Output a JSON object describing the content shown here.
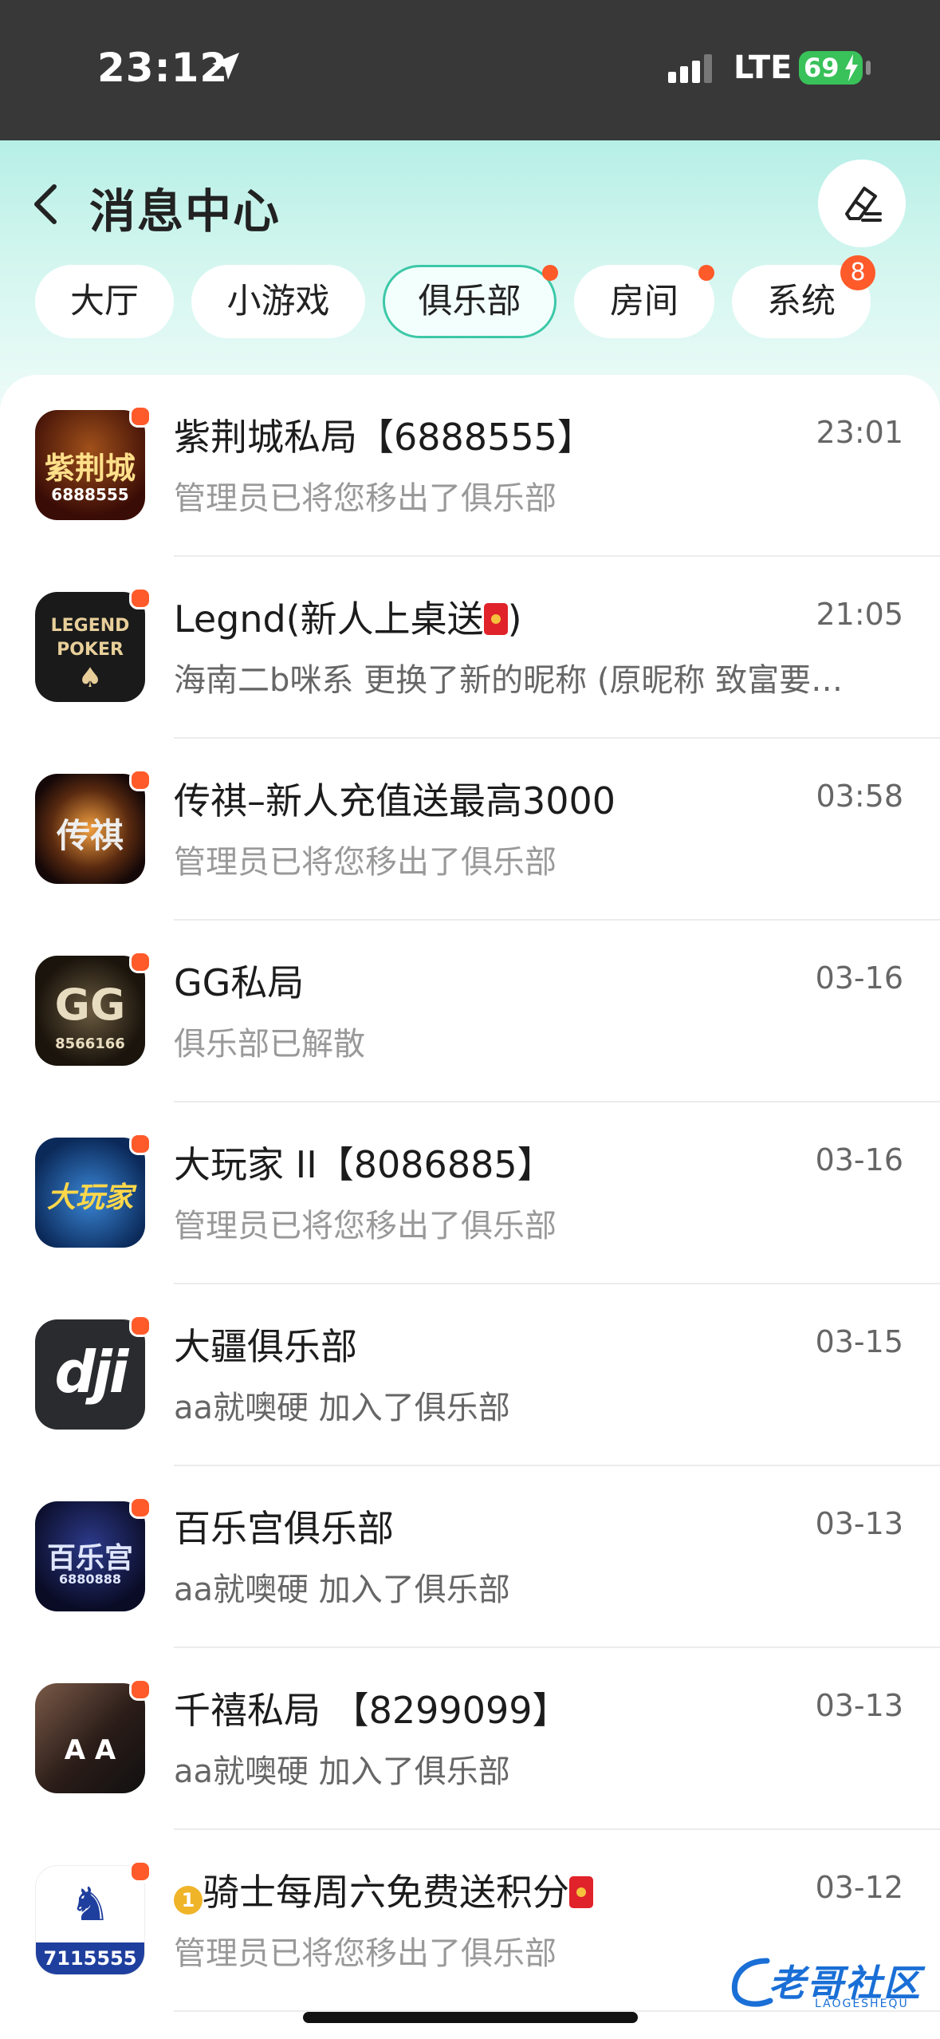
{
  "status_bar": {
    "time": "23:12",
    "network": "LTE",
    "battery": "69"
  },
  "header": {
    "title": "消息中心"
  },
  "tabs": [
    {
      "label": "大厅"
    },
    {
      "label": "小游戏"
    },
    {
      "label": "俱乐部"
    },
    {
      "label": "房间"
    },
    {
      "label": "系统",
      "badge": "8"
    }
  ],
  "messages": [
    {
      "name": "紫荆城私局【6888555】",
      "time": "23:01",
      "preview": "管理员已将您移出了俱乐部",
      "avatar_text": "紫荆城",
      "avatar_sub": "6888555"
    },
    {
      "name": "Legnd(新人上桌送",
      "name_tail": ")",
      "time": "21:05",
      "preview": "海南二b咪系 更换了新的昵称 (原昵称 致富要…",
      "avatar_text": "LEGEND",
      "avatar_sub": "POKER"
    },
    {
      "name": "传祺–新人充值送最高3000",
      "time": "03:58",
      "preview": "管理员已将您移出了俱乐部",
      "avatar_text": "传祺"
    },
    {
      "name": "GG私局",
      "time": "03-16",
      "preview": "俱乐部已解散",
      "avatar_text": "GG",
      "avatar_sub": "8566166"
    },
    {
      "name": "大玩家 II【8086885】",
      "time": "03-16",
      "preview": "管理员已将您移出了俱乐部",
      "avatar_text": "大玩家"
    },
    {
      "name": "大疆俱乐部",
      "time": "03-15",
      "preview": "aa就噢硬 加入了俱乐部",
      "avatar_text": "dji"
    },
    {
      "name": "百乐宫俱乐部",
      "time": "03-13",
      "preview": "aa就噢硬 加入了俱乐部",
      "avatar_text": "百乐宫",
      "avatar_sub": "6880888"
    },
    {
      "name": "千禧私局 【8299099】",
      "time": "03-13",
      "preview": "aa就噢硬 加入了俱乐部",
      "avatar_text": "A A"
    },
    {
      "name": "骑士每周六免费送积分",
      "time": "03-12",
      "preview": "管理员已将您移出了俱乐部",
      "avatar_text": "7115555"
    }
  ],
  "watermark": {
    "text": "老哥社区",
    "sub": "LAOGESHEQU"
  }
}
